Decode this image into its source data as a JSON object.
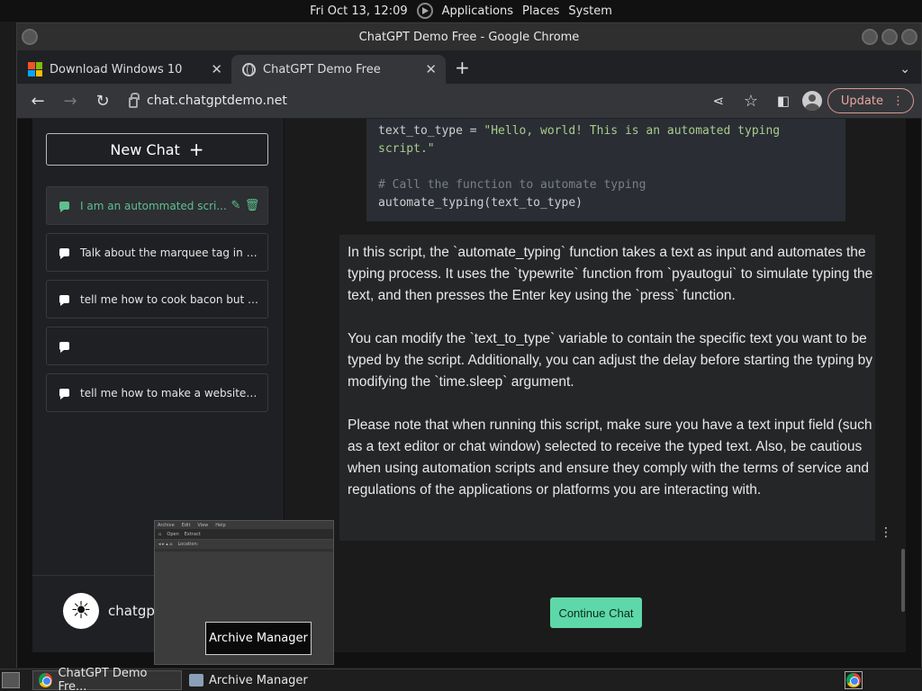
{
  "top_panel": {
    "clock": "Fri Oct 13, 12:09",
    "applications": "Applications",
    "places": "Places",
    "system": "System"
  },
  "window": {
    "title": "ChatGPT Demo Free - Google Chrome"
  },
  "tabs": [
    {
      "title": "Download Windows 10",
      "icon": "windows-logo-icon"
    },
    {
      "title": "ChatGPT Demo Free",
      "icon": "globe-icon"
    }
  ],
  "toolbar": {
    "url": "chat.chatgptdemo.net",
    "update_label": "Update"
  },
  "sidebar": {
    "new_chat_label": "New Chat",
    "chats": [
      {
        "label": "I am an autommated scri..."
      },
      {
        "label": "Talk about the marquee tag in gre..."
      },
      {
        "label": "tell me how to cook bacon but wri..."
      },
      {
        "label": ""
      },
      {
        "label": "tell me how to make a website but..."
      }
    ],
    "profile_name": "chatgpt"
  },
  "code": {
    "line1_var": "text_to_type = ",
    "line1_str": "\"Hello, world! This is an automated typing",
    "line2_str": "script.\"",
    "comment": "# Call the function to automate typing",
    "call": "automate_typing(text_to_type)"
  },
  "message": {
    "p1": "In this script, the `automate_typing` function takes a text as input and automates the typing process. It uses the `typewrite` function from `pyautogui` to simulate typing the text, and then presses the Enter key using the `press` function.",
    "p2": "You can modify the `text_to_type` variable to contain the specific text you want to be typed by the script. Additionally, you can adjust the delay before starting the typing by modifying the `time.sleep` argument.",
    "p3": "Please note that when running this script, make sure you have a text input field (such as a text editor or chat window) selected to receive the typed text. Also, be cautious when using automation scripts and ensure they comply with the terms of service and regulations of the applications or platforms you are interacting with."
  },
  "continue_label": "Continue Chat",
  "preview": {
    "menu": [
      "Archive",
      "Edit",
      "View",
      "Help"
    ],
    "open_label": "Open",
    "extract_label": "Extract",
    "location_label": "Location:"
  },
  "tooltip": "Archive Manager",
  "taskbar": {
    "tasks": [
      {
        "label": "ChatGPT Demo Fre..."
      },
      {
        "label": "Archive Manager"
      }
    ]
  },
  "colors": {
    "accent_green": "#5ed8a8",
    "update_outline": "#d89a92"
  }
}
